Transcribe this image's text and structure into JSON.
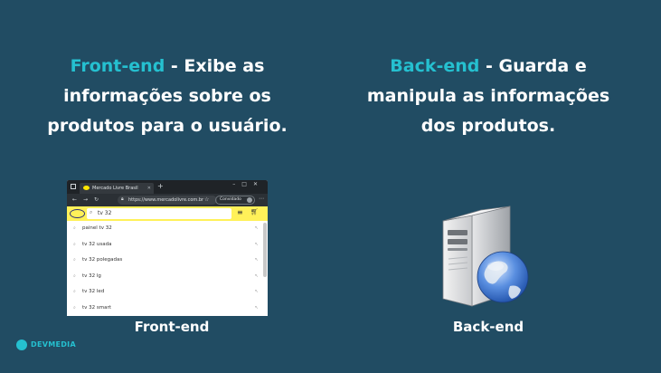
{
  "left_heading": {
    "accent": "Front-end",
    "line1_rest": " - Exibe as",
    "line2": "informações sobre os",
    "line3": "produtos para o usuário."
  },
  "right_heading": {
    "accent": "Back-end",
    "line1_rest": " - Guarda e",
    "line2": "manipula as informações",
    "line3": "dos produtos."
  },
  "captions": {
    "left": "Front-end",
    "right": "Back-end"
  },
  "browser": {
    "tab_title": "Mercado Livre Brasil",
    "url": "https://www.mercadolivre.com.br",
    "profile_label": "Convidado",
    "search_value": "tv 32",
    "suggestions": [
      "painel tv 32",
      "tv 32 usada",
      "tv 32 polegadas",
      "tv 32 lg",
      "tv 32 led",
      "tv 32 smart"
    ]
  },
  "brand": {
    "name": "DEVMEDIA"
  },
  "colors": {
    "background": "#214c63",
    "accent": "#25c0d0",
    "text": "#ffffff"
  }
}
